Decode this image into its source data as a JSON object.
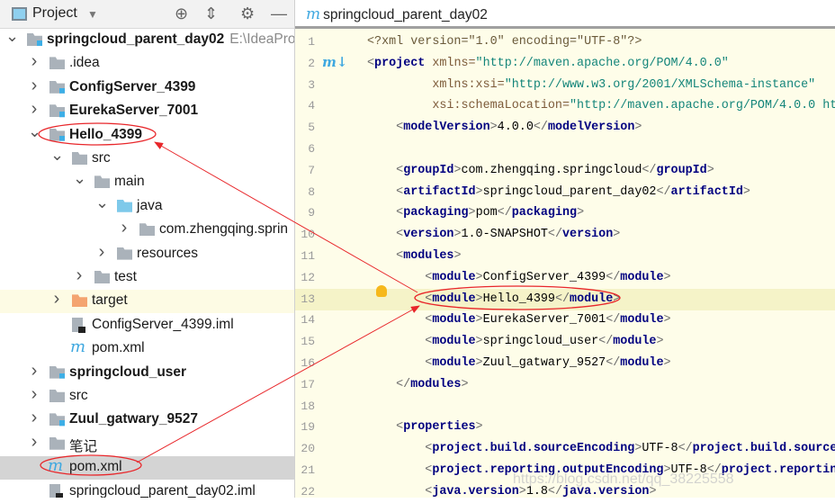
{
  "project_panel": {
    "title": "Project",
    "tree": [
      {
        "label": "springcloud_parent_day02",
        "path": "E:\\IdeaPro",
        "level": 0,
        "arrow": "open",
        "icon": "module",
        "bold": true
      },
      {
        "label": ".idea",
        "level": 1,
        "arrow": "closed",
        "icon": "folder"
      },
      {
        "label": "ConfigServer_4399",
        "level": 1,
        "arrow": "closed",
        "icon": "module",
        "bold": true
      },
      {
        "label": "EurekaServer_7001",
        "level": 1,
        "arrow": "closed",
        "icon": "module",
        "bold": true
      },
      {
        "label": "Hello_4399",
        "level": 1,
        "arrow": "open",
        "icon": "module",
        "bold": true
      },
      {
        "label": "src",
        "level": 2,
        "arrow": "open",
        "icon": "folder"
      },
      {
        "label": "main",
        "level": 3,
        "arrow": "open",
        "icon": "folder"
      },
      {
        "label": "java",
        "level": 4,
        "arrow": "open",
        "icon": "folder-blue"
      },
      {
        "label": "com.zhengqing.sprin",
        "level": 5,
        "arrow": "closed",
        "icon": "package"
      },
      {
        "label": "resources",
        "level": 4,
        "arrow": "closed",
        "icon": "resources"
      },
      {
        "label": "test",
        "level": 3,
        "arrow": "closed",
        "icon": "folder"
      },
      {
        "label": "target",
        "level": 2,
        "arrow": "closed",
        "icon": "folder-orange",
        "highlight": true
      },
      {
        "label": "ConfigServer_4399.iml",
        "level": 2,
        "arrow": "none",
        "icon": "iml"
      },
      {
        "label": "pom.xml",
        "level": 2,
        "arrow": "none",
        "icon": "maven"
      },
      {
        "label": "springcloud_user",
        "level": 1,
        "arrow": "closed",
        "icon": "module",
        "bold": true
      },
      {
        "label": "src",
        "level": 1,
        "arrow": "closed",
        "icon": "folder"
      },
      {
        "label": "Zuul_gatwary_9527",
        "level": 1,
        "arrow": "closed",
        "icon": "module",
        "bold": true
      },
      {
        "label": "笔记",
        "level": 1,
        "arrow": "closed",
        "icon": "folder"
      },
      {
        "label": "pom.xml",
        "level": 1,
        "arrow": "none",
        "icon": "maven",
        "selected": true
      },
      {
        "label": "springcloud_parent_day02.iml",
        "level": 1,
        "arrow": "none",
        "icon": "iml"
      }
    ]
  },
  "editor": {
    "tab_label": "springcloud_parent_day02",
    "current_line": 13,
    "lines": [
      [
        [
          "pi",
          "<?xml version=\"1.0\" encoding=\"UTF-8\"?>"
        ]
      ],
      [
        [
          "br",
          "<"
        ],
        [
          "tag",
          "project"
        ],
        [
          "attr",
          " xmlns="
        ],
        [
          "val",
          "\"http://maven.apache.org/POM/4.0.0\""
        ]
      ],
      [
        [
          "attr",
          "         xmlns:xsi="
        ],
        [
          "val",
          "\"http://www.w3.org/2001/XMLSchema-instance\""
        ]
      ],
      [
        [
          "attr",
          "         xsi:schemaLocation="
        ],
        [
          "val",
          "\"http://maven.apache.org/POM/4.0.0 ht"
        ]
      ],
      [
        [
          "br",
          "    <"
        ],
        [
          "tag",
          "modelVersion"
        ],
        [
          "br",
          ">"
        ],
        [
          "txt",
          "4.0.0"
        ],
        [
          "br",
          "</"
        ],
        [
          "tag",
          "modelVersion"
        ],
        [
          "br",
          ">"
        ]
      ],
      [],
      [
        [
          "br",
          "    <"
        ],
        [
          "tag",
          "groupId"
        ],
        [
          "br",
          ">"
        ],
        [
          "txt",
          "com.zhengqing.springcloud"
        ],
        [
          "br",
          "</"
        ],
        [
          "tag",
          "groupId"
        ],
        [
          "br",
          ">"
        ]
      ],
      [
        [
          "br",
          "    <"
        ],
        [
          "tag",
          "artifactId"
        ],
        [
          "br",
          ">"
        ],
        [
          "txt",
          "springcloud_parent_day02"
        ],
        [
          "br",
          "</"
        ],
        [
          "tag",
          "artifactId"
        ],
        [
          "br",
          ">"
        ]
      ],
      [
        [
          "br",
          "    <"
        ],
        [
          "tag",
          "packaging"
        ],
        [
          "br",
          ">"
        ],
        [
          "txt",
          "pom"
        ],
        [
          "br",
          "</"
        ],
        [
          "tag",
          "packaging"
        ],
        [
          "br",
          ">"
        ]
      ],
      [
        [
          "br",
          "    <"
        ],
        [
          "tag",
          "version"
        ],
        [
          "br",
          ">"
        ],
        [
          "txt",
          "1.0-SNAPSHOT"
        ],
        [
          "br",
          "</"
        ],
        [
          "tag",
          "version"
        ],
        [
          "br",
          ">"
        ]
      ],
      [
        [
          "br",
          "    <"
        ],
        [
          "tag",
          "modules"
        ],
        [
          "br",
          ">"
        ]
      ],
      [
        [
          "br",
          "        <"
        ],
        [
          "tag",
          "module"
        ],
        [
          "br",
          ">"
        ],
        [
          "txt",
          "ConfigServer_4399"
        ],
        [
          "br",
          "</"
        ],
        [
          "tag",
          "module"
        ],
        [
          "br",
          ">"
        ]
      ],
      [
        [
          "br",
          "        <"
        ],
        [
          "tag",
          "module"
        ],
        [
          "br",
          ">"
        ],
        [
          "txt",
          "Hello_4399"
        ],
        [
          "br",
          "</"
        ],
        [
          "tag",
          "module"
        ],
        [
          "br",
          ">"
        ]
      ],
      [
        [
          "br",
          "        <"
        ],
        [
          "tag",
          "module"
        ],
        [
          "br",
          ">"
        ],
        [
          "txt",
          "EurekaServer_7001"
        ],
        [
          "br",
          "</"
        ],
        [
          "tag",
          "module"
        ],
        [
          "br",
          ">"
        ]
      ],
      [
        [
          "br",
          "        <"
        ],
        [
          "tag",
          "module"
        ],
        [
          "br",
          ">"
        ],
        [
          "txt",
          "springcloud_user"
        ],
        [
          "br",
          "</"
        ],
        [
          "tag",
          "module"
        ],
        [
          "br",
          ">"
        ]
      ],
      [
        [
          "br",
          "        <"
        ],
        [
          "tag",
          "module"
        ],
        [
          "br",
          ">"
        ],
        [
          "txt",
          "Zuul_gatwary_9527"
        ],
        [
          "br",
          "</"
        ],
        [
          "tag",
          "module"
        ],
        [
          "br",
          ">"
        ]
      ],
      [
        [
          "br",
          "    </"
        ],
        [
          "tag",
          "modules"
        ],
        [
          "br",
          ">"
        ]
      ],
      [],
      [
        [
          "br",
          "    <"
        ],
        [
          "tag",
          "properties"
        ],
        [
          "br",
          ">"
        ]
      ],
      [
        [
          "br",
          "        <"
        ],
        [
          "tag",
          "project.build.sourceEncoding"
        ],
        [
          "br",
          ">"
        ],
        [
          "txt",
          "UTF-8"
        ],
        [
          "br",
          "</"
        ],
        [
          "tag",
          "project.build.source"
        ]
      ],
      [
        [
          "br",
          "        <"
        ],
        [
          "tag",
          "project.reporting.outputEncoding"
        ],
        [
          "br",
          ">"
        ],
        [
          "txt",
          "UTF-8"
        ],
        [
          "br",
          "</"
        ],
        [
          "tag",
          "project.reportin"
        ]
      ],
      [
        [
          "br",
          "        <"
        ],
        [
          "tag",
          "java.version"
        ],
        [
          "br",
          ">"
        ],
        [
          "txt",
          "1.8"
        ],
        [
          "br",
          "</"
        ],
        [
          "tag",
          "java.version"
        ],
        [
          "br",
          ">"
        ]
      ]
    ]
  },
  "watermark": "https://blog.csdn.net/qq_38225558",
  "colors": {
    "annotation": "#e8262a",
    "selection": "#d4d4d4",
    "editor_bg": "#fefde9"
  }
}
